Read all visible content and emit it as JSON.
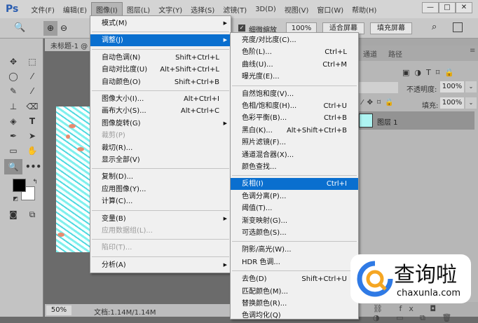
{
  "app": {
    "logo": "Ps"
  },
  "menubar": [
    "文件(F)",
    "编辑(E)",
    "图像(I)",
    "图层(L)",
    "文字(Y)",
    "选择(S)",
    "滤镜(T)",
    "3D(D)",
    "视图(V)",
    "窗口(W)",
    "帮助(H)"
  ],
  "window_controls": [
    "—",
    "□",
    "✕"
  ],
  "options": {
    "scrubby_zoom": "细微缩放",
    "zoom_pct": "100%",
    "fit_screen": "适合屏幕",
    "fill_screen": "填充屏幕"
  },
  "document": {
    "tab": "未标题-1 @",
    "zoom": "50%",
    "doc_info": "文档:1.14M/1.14M"
  },
  "image_menu": [
    {
      "label": "模式(M)",
      "sub": true
    },
    {
      "sep": true
    },
    {
      "label": "调整(J)",
      "sub": true,
      "hl": true
    },
    {
      "sep": true
    },
    {
      "label": "自动色调(N)",
      "sc": "Shift+Ctrl+L"
    },
    {
      "label": "自动对比度(U)",
      "sc": "Alt+Shift+Ctrl+L"
    },
    {
      "label": "自动颜色(O)",
      "sc": "Shift+Ctrl+B"
    },
    {
      "sep": true
    },
    {
      "label": "图像大小(I)...",
      "sc": "Alt+Ctrl+I"
    },
    {
      "label": "画布大小(S)...",
      "sc": "Alt+Ctrl+C"
    },
    {
      "label": "图像旋转(G)",
      "sub": true
    },
    {
      "label": "裁剪(P)",
      "dis": true
    },
    {
      "label": "裁切(R)..."
    },
    {
      "label": "显示全部(V)"
    },
    {
      "sep": true
    },
    {
      "label": "复制(D)..."
    },
    {
      "label": "应用图像(Y)..."
    },
    {
      "label": "计算(C)..."
    },
    {
      "sep": true
    },
    {
      "label": "变量(B)",
      "sub": true
    },
    {
      "label": "应用数据组(L)...",
      "dis": true
    },
    {
      "sep": true
    },
    {
      "label": "陷印(T)...",
      "dis": true
    },
    {
      "sep": true
    },
    {
      "label": "分析(A)",
      "sub": true
    }
  ],
  "adjust_menu": [
    {
      "label": "亮度/对比度(C)..."
    },
    {
      "label": "色阶(L)...",
      "sc": "Ctrl+L"
    },
    {
      "label": "曲线(U)...",
      "sc": "Ctrl+M"
    },
    {
      "label": "曝光度(E)..."
    },
    {
      "sep": true
    },
    {
      "label": "自然饱和度(V)..."
    },
    {
      "label": "色相/饱和度(H)...",
      "sc": "Ctrl+U"
    },
    {
      "label": "色彩平衡(B)...",
      "sc": "Ctrl+B"
    },
    {
      "label": "黑白(K)...",
      "sc": "Alt+Shift+Ctrl+B"
    },
    {
      "label": "照片滤镜(F)..."
    },
    {
      "label": "通道混合器(X)..."
    },
    {
      "label": "颜色查找..."
    },
    {
      "sep": true
    },
    {
      "label": "反相(I)",
      "sc": "Ctrl+I",
      "hl": true
    },
    {
      "label": "色调分离(P)..."
    },
    {
      "label": "阈值(T)..."
    },
    {
      "label": "渐变映射(G)..."
    },
    {
      "label": "可选颜色(S)..."
    },
    {
      "sep": true
    },
    {
      "label": "阴影/高光(W)..."
    },
    {
      "label": "HDR 色调..."
    },
    {
      "sep": true
    },
    {
      "label": "去色(D)",
      "sc": "Shift+Ctrl+U"
    },
    {
      "label": "匹配颜色(M)..."
    },
    {
      "label": "替换颜色(R)..."
    },
    {
      "label": "色调均化(Q)"
    }
  ],
  "panel": {
    "tabs": [
      "通道",
      "路径"
    ],
    "opacity_label": "不透明度:",
    "opacity": "100%",
    "fill_label": "填充:",
    "fill": "100%",
    "layer_name": "图层 1"
  },
  "watermark": {
    "name": "查询啦",
    "url": "chaxunla.com"
  },
  "colors": {
    "accent": "#0a6fcf",
    "foreground": "#000000",
    "background": "#ffffff"
  }
}
